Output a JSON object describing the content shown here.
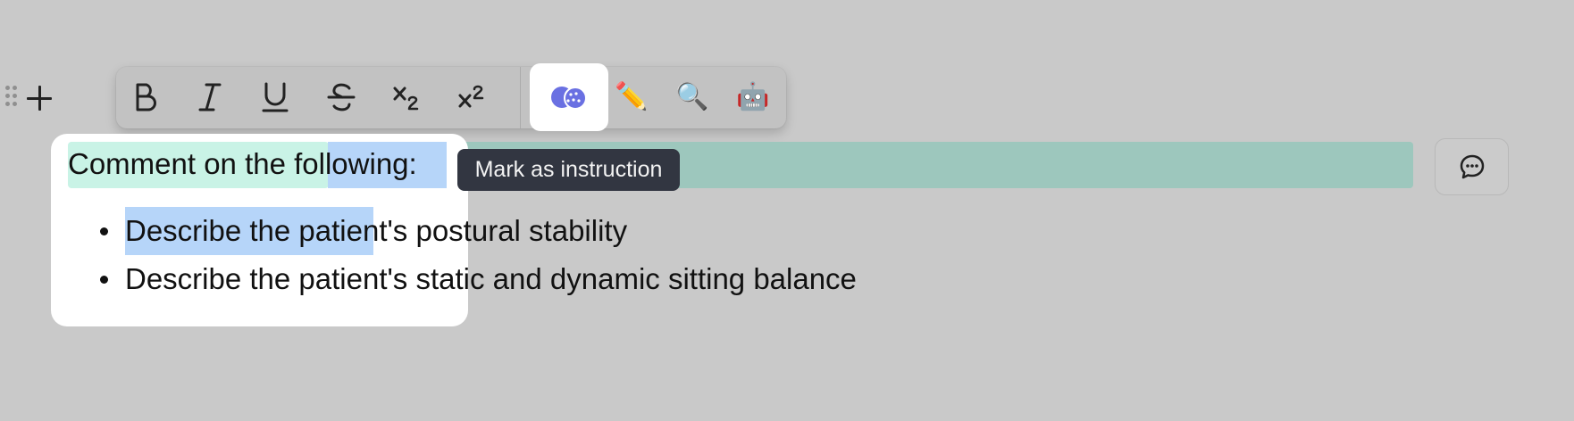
{
  "gutter": {
    "drag_icon": "drag-handle-icon",
    "add_icon": "plus-icon"
  },
  "toolbar": {
    "buttons": [
      {
        "name": "bold",
        "glyph": "B"
      },
      {
        "name": "italic",
        "glyph": "I"
      },
      {
        "name": "underline",
        "glyph": "U"
      },
      {
        "name": "strikethrough",
        "glyph": "S"
      },
      {
        "name": "subscript",
        "glyph": "x₂"
      },
      {
        "name": "superscript",
        "glyph": "x²"
      }
    ],
    "actions": [
      {
        "name": "mark-instruction",
        "icon": "instruction-icon",
        "active": true
      },
      {
        "name": "edit",
        "emoji": "✏️"
      },
      {
        "name": "search",
        "emoji": "🔍"
      },
      {
        "name": "ai-assistant",
        "emoji": "🤖"
      }
    ]
  },
  "document": {
    "heading": "Comment on the following:",
    "bullets": [
      "Describe the patient's postural stability",
      "Describe the patient's static and dynamic sitting balance"
    ]
  },
  "tooltip": {
    "text": "Mark as instruction"
  },
  "comment_button": {
    "icon": "comment-icon"
  },
  "colors": {
    "background": "#c9c9c9",
    "selection_blue": "#b6d5f9",
    "instruction_mint": "#c9f3e6",
    "instruction_teal": "#9dc7bd",
    "tooltip_bg": "#323641",
    "active_icon": "#6a70e2"
  }
}
